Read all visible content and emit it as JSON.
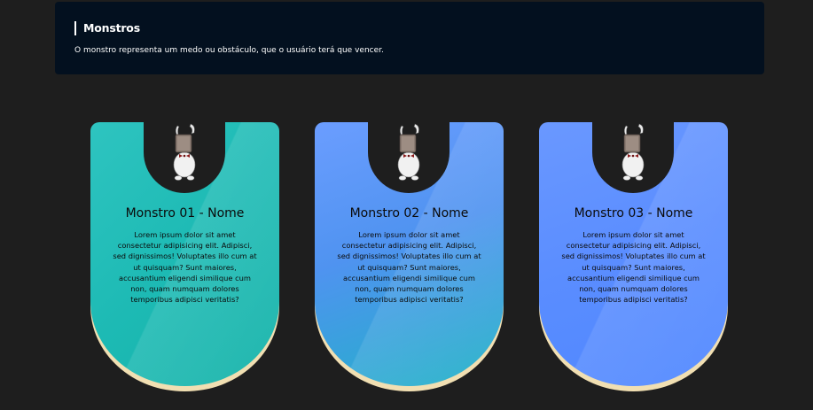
{
  "header": {
    "title": "Monstros",
    "description": "O monstro representa um medo ou obstáculo, que o usuário terá que vencer."
  },
  "cards": [
    {
      "name": "Monstro 01 - Nome",
      "description": "Lorem ipsum dolor sit amet consectetur adipisicing elit. Adipisci, sed dignissimos! Voluptates illo cum at ut quisquam? Sunt maiores, accusantium eligendi similique cum non, quam numquam dolores temporibus adipisci veritatis?",
      "avatar_icon": "bunny-monster-icon"
    },
    {
      "name": "Monstro 02 - Nome",
      "description": "Lorem ipsum dolor sit amet consectetur adipisicing elit. Adipisci, sed dignissimos! Voluptates illo cum at ut quisquam? Sunt maiores, accusantium eligendi similique cum non, quam numquam dolores temporibus adipisci veritatis?",
      "avatar_icon": "bunny-monster-icon"
    },
    {
      "name": "Monstro 03 - Nome",
      "description": "Lorem ipsum dolor sit amet consectetur adipisicing elit. Adipisci, sed dignissimos! Voluptates illo cum at ut quisquam? Sunt maiores, accusantium eligendi similique cum non, quam numquam dolores temporibus adipisci veritatis?",
      "avatar_icon": "bunny-monster-icon"
    }
  ],
  "colors": {
    "page_background": "#1e1e1e",
    "header_background": "#03101f",
    "card_shadow": "#f1dfb2",
    "card_1": "#1dbab4",
    "card_2": "#4f93f0",
    "card_3": "#5a8dff"
  }
}
